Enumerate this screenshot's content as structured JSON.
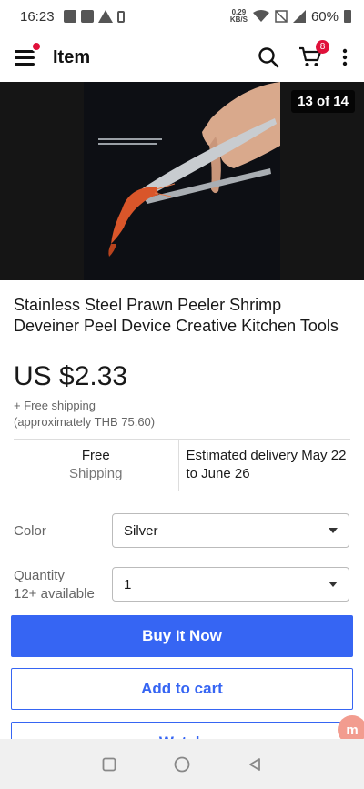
{
  "status_bar": {
    "time": "16:23",
    "net_speed_value": "0.29",
    "net_speed_unit": "KB/S",
    "battery": "60%"
  },
  "header": {
    "title": "Item",
    "cart_count": "8"
  },
  "gallery": {
    "counter": "13 of 14"
  },
  "product": {
    "title": "Stainless Steel Prawn Peeler Shrimp Deveiner Peel Device Creative Kitchen Tools",
    "price": "US $2.33",
    "shipping_line": "+ Free shipping",
    "approx_price": "(approximately THB 75.60)"
  },
  "info": {
    "shipping_title": "Free",
    "shipping_subtitle": "Shipping",
    "delivery": "Estimated delivery May 22 to June 26"
  },
  "options": {
    "color_label": "Color",
    "color_value": "Silver",
    "quantity_label": "Quantity",
    "quantity_available": "12+ available",
    "quantity_value": "1"
  },
  "actions": {
    "buy_now": "Buy It Now",
    "add_to_cart": "Add to cart",
    "watch": "Watch"
  },
  "floating_button_text": "m",
  "colors": {
    "accent": "#3665f3",
    "badge": "#e0103a"
  }
}
